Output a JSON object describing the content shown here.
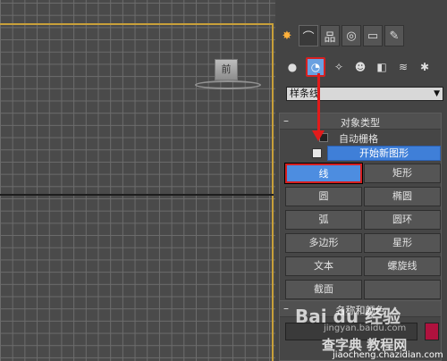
{
  "viewport": {
    "viewcube_label": "前"
  },
  "panel": {
    "top_tabs": [
      {
        "icon": "create-star-icon",
        "glyph": "✸"
      },
      {
        "icon": "modify-curve-icon",
        "glyph": "⌒"
      },
      {
        "icon": "hierarchy-icon",
        "glyph": "品"
      },
      {
        "icon": "motion-icon",
        "glyph": "◎"
      },
      {
        "icon": "display-monitor-icon",
        "glyph": "▭"
      },
      {
        "icon": "utilities-hammer-icon",
        "glyph": "✎"
      }
    ],
    "sub_icons": [
      {
        "icon": "geometry-sphere-icon",
        "glyph": "●"
      },
      {
        "icon": "shapes-icon",
        "glyph": "◔"
      },
      {
        "icon": "lights-icon",
        "glyph": "✧"
      },
      {
        "icon": "cameras-icon",
        "glyph": "☻"
      },
      {
        "icon": "helpers-icon",
        "glyph": "◧"
      },
      {
        "icon": "space-warps-icon",
        "glyph": "≋"
      },
      {
        "icon": "systems-icon",
        "glyph": "✱"
      }
    ],
    "category_dropdown": "样条线",
    "object_type": {
      "title": "对象类型",
      "autogrid_label": "自动栅格",
      "start_new_shape": "开始新图形",
      "buttons": [
        "线",
        "矩形",
        "圆",
        "椭圆",
        "弧",
        "圆环",
        "多边形",
        "星形",
        "文本",
        "螺旋线",
        "截面",
        ""
      ],
      "selected": "线"
    },
    "name_color": {
      "title": "名称和颜色",
      "swatch_color": "#b0123e"
    }
  },
  "watermark": {
    "main": "Bai du 经验",
    "sub1": "jingyan.baidu.com",
    "sub2": "查字典 教程网",
    "url": "jiaocheng.chazidian.com"
  }
}
